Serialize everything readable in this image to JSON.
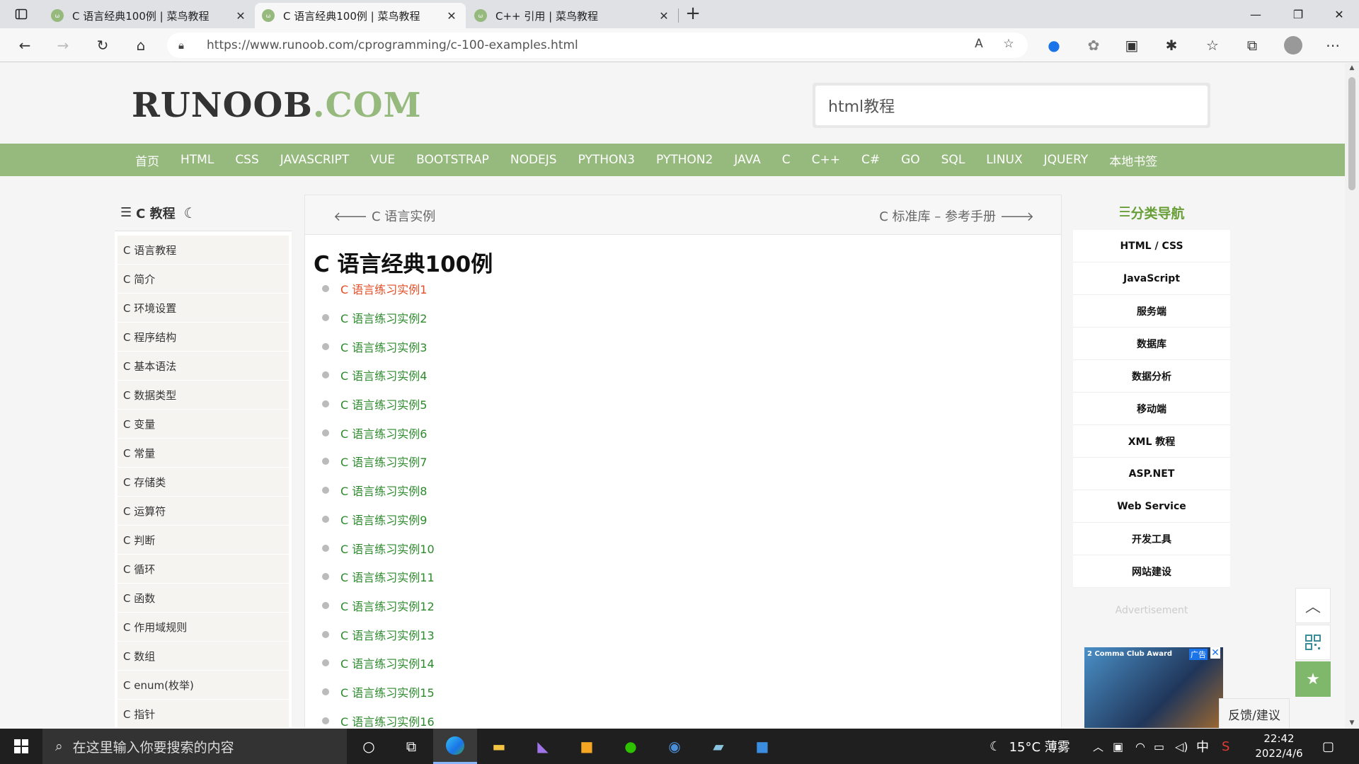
{
  "browser": {
    "tabs": [
      {
        "title": "C 语言经典100例 | 菜鸟教程",
        "active": false
      },
      {
        "title": "C 语言经典100例 | 菜鸟教程",
        "active": true
      },
      {
        "title": "C++ 引用 | 菜鸟教程",
        "active": false
      }
    ],
    "new_tab": "+",
    "url": "https://www.runoob.com/cprogramming/c-100-examples.html"
  },
  "site": {
    "logo_main": "RUNOOB",
    "logo_dot": ".COM",
    "search_value": "html教程",
    "nav": [
      "首页",
      "HTML",
      "CSS",
      "JAVASCRIPT",
      "VUE",
      "BOOTSTRAP",
      "NODEJS",
      "PYTHON3",
      "PYTHON2",
      "JAVA",
      "C",
      "C++",
      "C#",
      "GO",
      "SQL",
      "LINUX",
      "JQUERY",
      "本地书签"
    ]
  },
  "left_sidebar": {
    "title": "C 教程",
    "items": [
      "C 语言教程",
      "C 简介",
      "C 环境设置",
      "C 程序结构",
      "C 基本语法",
      "C 数据类型",
      "C 变量",
      "C 常量",
      "C 存储类",
      "C 运算符",
      "C 判断",
      "C 循环",
      "C 函数",
      "C 作用域规则",
      "C 数组",
      "C enum(枚举)",
      "C 指针"
    ]
  },
  "main": {
    "prev": "C 语言实例",
    "next": "C 标准库 – 参考手册",
    "title": "C 语言经典100例",
    "examples": [
      "C 语言练习实例1",
      "C 语言练习实例2",
      "C 语言练习实例3",
      "C 语言练习实例4",
      "C 语言练习实例5",
      "C 语言练习实例6",
      "C 语言练习实例7",
      "C 语言练习实例8",
      "C 语言练习实例9",
      "C 语言练习实例10",
      "C 语言练习实例11",
      "C 语言练习实例12",
      "C 语言练习实例13",
      "C 语言练习实例14",
      "C 语言练习实例15",
      "C 语言练习实例16"
    ]
  },
  "right_sidebar": {
    "title": "分类导航",
    "items": [
      "HTML / CSS",
      "JavaScript",
      "服务端",
      "数据库",
      "数据分析",
      "移动端",
      "XML 教程",
      "ASP.NET",
      "Web Service",
      "开发工具",
      "网站建设"
    ],
    "ad_label": "Advertisement",
    "ad_text": "2 Comma Club Award",
    "ad_tag": "广告"
  },
  "floating": {
    "feedback": "反馈/建议"
  },
  "taskbar": {
    "search_placeholder": "在这里输入你要搜索的内容",
    "weather": "15°C  薄雾",
    "ime": "中",
    "time": "22:42",
    "date": "2022/4/6"
  },
  "colors": {
    "brand_green": "#96b97d",
    "link_green": "#2c8a2c",
    "visited": "#e44d26"
  }
}
